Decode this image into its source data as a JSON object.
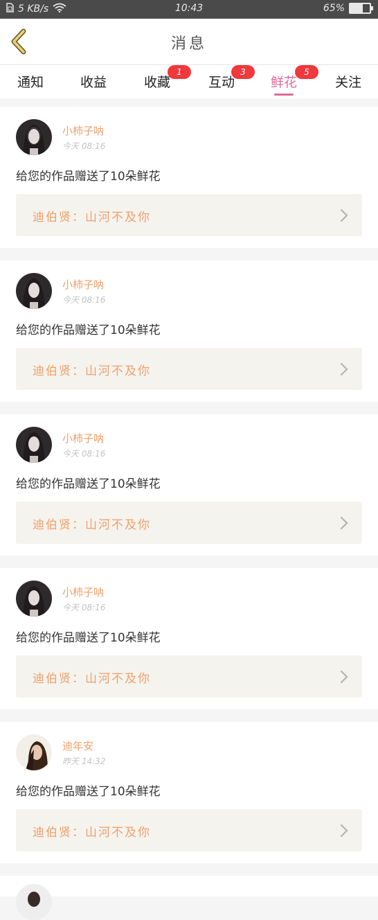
{
  "status_bar": {
    "network_speed": "5 KB/s",
    "time": "10:43",
    "battery": "65%",
    "battery_level": 0.65,
    "icons": [
      "sim-card-icon",
      "wifi-icon",
      "battery-icon"
    ]
  },
  "header": {
    "back_icon": "chevron-left-icon",
    "title": "消息"
  },
  "tabs": [
    {
      "label": "通知",
      "badge": ""
    },
    {
      "label": "收益",
      "badge": ""
    },
    {
      "label": "收藏",
      "badge": "1"
    },
    {
      "label": "互动",
      "badge": "3"
    },
    {
      "label": "鲜花",
      "badge": "5",
      "active": true
    },
    {
      "label": "关注",
      "badge": ""
    }
  ],
  "colors": {
    "accent_pink": "#e06a96",
    "name_orange": "#f0a06a",
    "badge_red": "#f0383d",
    "ref_bg": "#f4f3ee"
  },
  "messages": [
    {
      "user": "小柿子呐",
      "time": "今天 08:16",
      "text": "给您的作品赠送了10朵鲜花",
      "ref": "迪伯贤：山河不及你",
      "avatar": "avatar-icon"
    },
    {
      "user": "小柿子呐",
      "time": "今天 08:16",
      "text": "给您的作品赠送了10朵鲜花",
      "ref": "迪伯贤：山河不及你",
      "avatar": "avatar-icon"
    },
    {
      "user": "小柿子呐",
      "time": "今天 08:16",
      "text": "给您的作品赠送了10朵鲜花",
      "ref": "迪伯贤：山河不及你",
      "avatar": "avatar-icon"
    },
    {
      "user": "小柿子呐",
      "time": "今天 08:16",
      "text": "给您的作品赠送了10朵鲜花",
      "ref": "迪伯贤：山河不及你",
      "avatar": "avatar-icon"
    },
    {
      "user": "迪年安",
      "time": "昨天 14:32",
      "text": "给您的作品赠送了10朵鲜花",
      "ref": "迪伯贤：山河不及你",
      "avatar": "avatar-icon"
    }
  ]
}
